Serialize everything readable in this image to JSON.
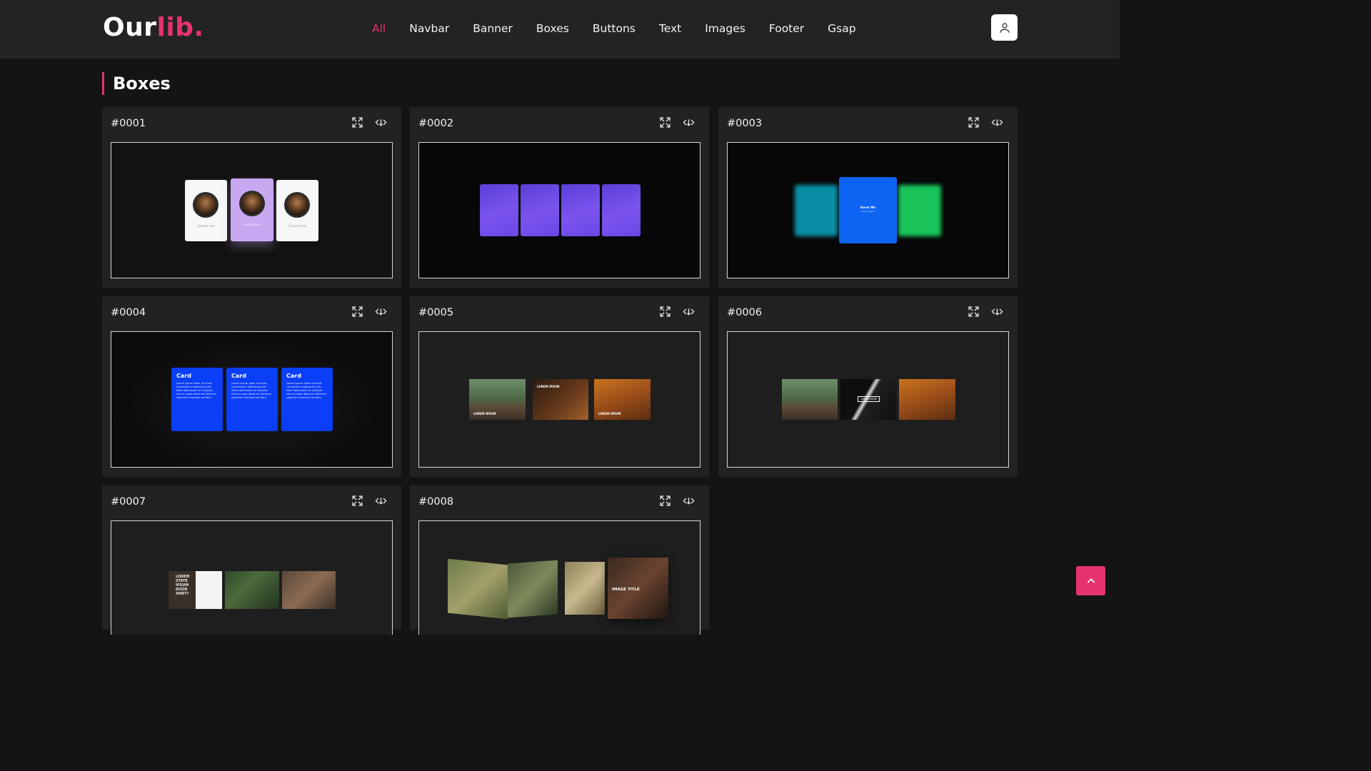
{
  "brand": {
    "part1": "Our",
    "part2": "lib."
  },
  "nav": {
    "items": [
      "All",
      "Navbar",
      "Banner",
      "Boxes",
      "Buttons",
      "Text",
      "Images",
      "Footer",
      "Gsap"
    ],
    "active": "All"
  },
  "section": {
    "title": "Boxes"
  },
  "cards": [
    {
      "id": "#0001"
    },
    {
      "id": "#0002"
    },
    {
      "id": "#0003"
    },
    {
      "id": "#0004"
    },
    {
      "id": "#0005"
    },
    {
      "id": "#0006"
    },
    {
      "id": "#0007"
    },
    {
      "id": "#0008"
    }
  ],
  "previews": {
    "p1": {
      "caption": "Sample text"
    },
    "p3": {
      "title": "Hover Me",
      "subtitle": "Lorem Ipsum"
    },
    "p4": {
      "card_title": "Card",
      "card_body": "Lorem ipsum dolor sit amet, consectetur adipisicing elit. Modi laboriosam et voluptas chinus culpa deserunt delectus sapiente inventore pariatur"
    },
    "p5": {
      "label1": "LOREM IPSUM",
      "label2": "LOREM IPSUM",
      "label3": "LOREM IPSUM"
    },
    "p6": {
      "button": "LEARN MORE"
    },
    "p7": {
      "text": "LOREM STATE IPSUM DOOR AMET?"
    },
    "p8": {
      "title": "IMAGE TITLE"
    }
  },
  "colors": {
    "accent": "#e5336e",
    "header_bg": "#232323",
    "page_bg": "#141414",
    "card_bg": "#222222"
  },
  "icons": {
    "user": "user-icon",
    "expand": "expand-icon",
    "code": "code-icon",
    "scroll_top": "chevron-up-icon"
  }
}
